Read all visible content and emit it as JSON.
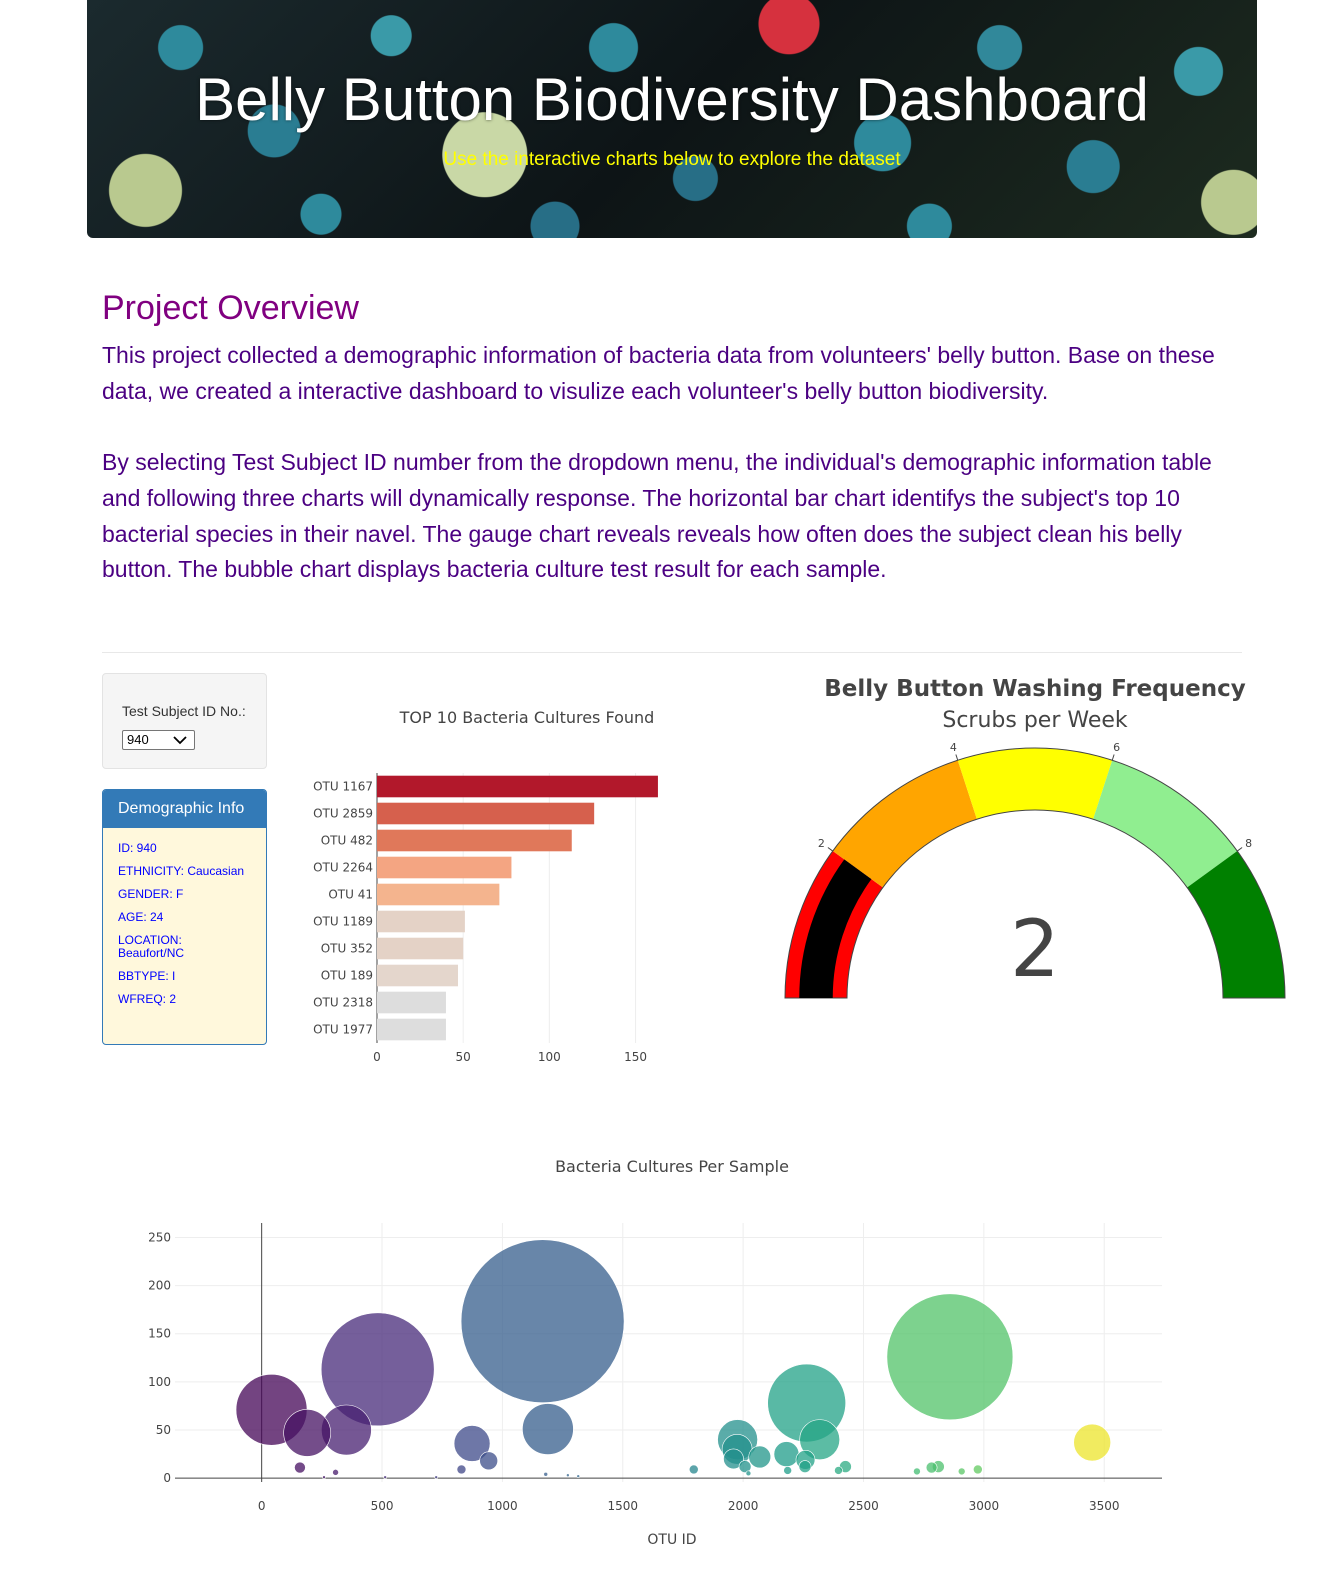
{
  "banner": {
    "title": "Belly Button Biodiversity Dashboard",
    "subtitle": "Use the interactive charts below to explore the dataset"
  },
  "overview": {
    "title": "Project Overview",
    "paragraph1": "This project collected a demographic information of bacteria data from volunteers' belly button. Base on these data, we created a interactive dashboard to visulize each volunteer's belly button biodiversity.",
    "paragraph2": "By selecting Test Subject ID number from the dropdown menu, the individual's demographic information table and following three charts will dynamically response. The horizontal bar chart identifys the subject's top 10 bacterial species in their navel. The gauge chart reveals reveals how often does the subject clean his belly button. The bubble chart displays bacteria culture test result for each sample."
  },
  "selector": {
    "label": "Test Subject ID No.:",
    "selected": "940"
  },
  "demographic": {
    "heading": "Demographic Info",
    "lines": [
      "ID: 940",
      "ETHNICITY: Caucasian",
      "GENDER: F",
      "AGE: 24",
      "LOCATION: Beaufort/NC",
      "BBTYPE: I",
      "WFREQ: 2"
    ]
  },
  "colors": {
    "title": "#800080",
    "text": "#4b0082",
    "panel_head": "#337ab7",
    "panel_body": "#fff8dc",
    "demo_text": "#0000ff",
    "banner_subtitle": "#ffff00"
  },
  "chart_data": [
    {
      "type": "bar",
      "orientation": "horizontal",
      "title": "TOP 10 Bacteria Cultures Found",
      "categories": [
        "OTU 1167",
        "OTU 2859",
        "OTU 482",
        "OTU 2264",
        "OTU 41",
        "OTU 1189",
        "OTU 352",
        "OTU 189",
        "OTU 2318",
        "OTU 1977"
      ],
      "values": [
        163,
        126,
        113,
        78,
        71,
        51,
        50,
        47,
        40,
        40
      ],
      "colors": [
        "#b2182b",
        "#d6604d",
        "#e0785a",
        "#f4a582",
        "#f4b48e",
        "#e4d2c6",
        "#e4d2c6",
        "#e4d6cc",
        "#dddddd",
        "#dddddd"
      ],
      "xticks": [
        0,
        50,
        100,
        150
      ],
      "xlim": [
        0,
        170
      ],
      "grid": true
    },
    {
      "type": "gauge",
      "title": "Belly Button Washing Frequency",
      "subtitle": "Scrubs per Week",
      "value": 2,
      "range": [
        0,
        10
      ],
      "ticks": [
        2,
        4,
        6,
        8
      ],
      "steps": [
        {
          "range": [
            0,
            2
          ],
          "color": "#ff0000"
        },
        {
          "range": [
            2,
            4
          ],
          "color": "#ffa500"
        },
        {
          "range": [
            4,
            6
          ],
          "color": "#ffff00"
        },
        {
          "range": [
            6,
            8
          ],
          "color": "#90ee90"
        },
        {
          "range": [
            8,
            10
          ],
          "color": "#008000"
        }
      ],
      "bar_color": "#000000"
    },
    {
      "type": "scatter",
      "mode": "bubble",
      "title": "Bacteria Cultures Per Sample",
      "xlabel": "OTU ID",
      "ylabel": "",
      "xticks": [
        0,
        500,
        1000,
        1500,
        2000,
        2500,
        3000,
        3500
      ],
      "yticks": [
        0,
        50,
        100,
        150,
        200,
        250
      ],
      "xlim": [
        -360,
        3740
      ],
      "ylim": [
        -4,
        265
      ],
      "grid": true,
      "colorscale": "Viridis",
      "points": [
        {
          "x": 41,
          "y": 71
        },
        {
          "x": 159,
          "y": 11
        },
        {
          "x": 189,
          "y": 47
        },
        {
          "x": 259,
          "y": 1
        },
        {
          "x": 307,
          "y": 6
        },
        {
          "x": 352,
          "y": 50
        },
        {
          "x": 482,
          "y": 113
        },
        {
          "x": 513,
          "y": 1
        },
        {
          "x": 725,
          "y": 1
        },
        {
          "x": 830,
          "y": 9
        },
        {
          "x": 874,
          "y": 36
        },
        {
          "x": 943,
          "y": 18
        },
        {
          "x": 1167,
          "y": 163
        },
        {
          "x": 1189,
          "y": 51
        },
        {
          "x": 1180,
          "y": 4
        },
        {
          "x": 1272,
          "y": 3
        },
        {
          "x": 1315,
          "y": 2
        },
        {
          "x": 1795,
          "y": 9
        },
        {
          "x": 1977,
          "y": 40
        },
        {
          "x": 1975,
          "y": 30
        },
        {
          "x": 1960,
          "y": 20
        },
        {
          "x": 2008,
          "y": 12
        },
        {
          "x": 2022,
          "y": 5
        },
        {
          "x": 2069,
          "y": 22
        },
        {
          "x": 2180,
          "y": 25
        },
        {
          "x": 2185,
          "y": 8
        },
        {
          "x": 2264,
          "y": 78
        },
        {
          "x": 2318,
          "y": 40
        },
        {
          "x": 2259,
          "y": 19
        },
        {
          "x": 2257,
          "y": 12
        },
        {
          "x": 2396,
          "y": 8
        },
        {
          "x": 2425,
          "y": 12
        },
        {
          "x": 2722,
          "y": 7
        },
        {
          "x": 2783,
          "y": 11
        },
        {
          "x": 2811,
          "y": 12
        },
        {
          "x": 2859,
          "y": 126
        },
        {
          "x": 2908,
          "y": 7
        },
        {
          "x": 2975,
          "y": 9
        },
        {
          "x": 3450,
          "y": 37
        }
      ]
    }
  ]
}
